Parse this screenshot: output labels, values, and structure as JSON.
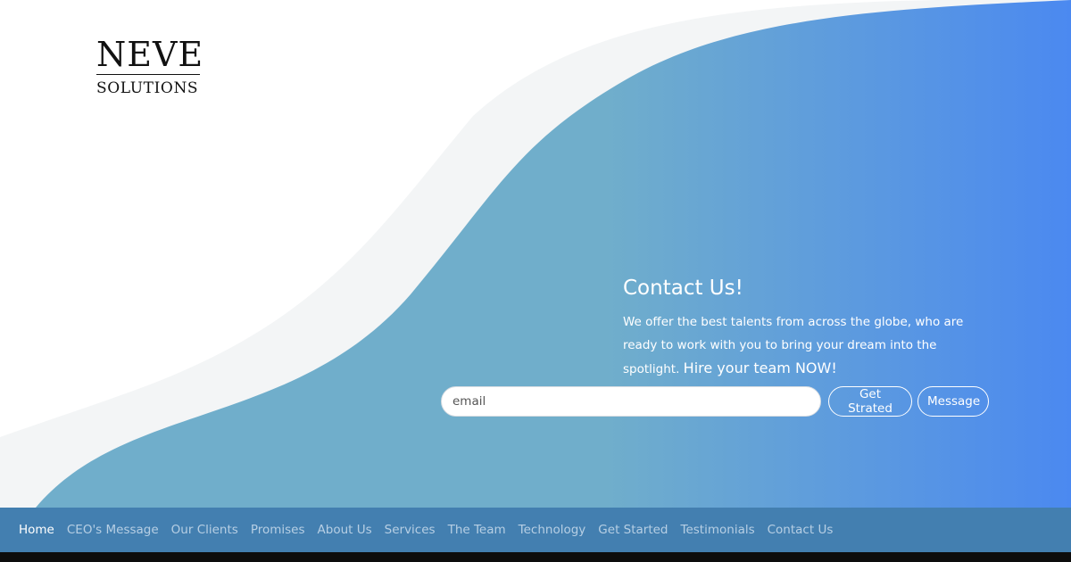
{
  "logo": {
    "main": "NEVE",
    "sub": "SOLUTIONS"
  },
  "hero": {
    "title": "Contact Us!",
    "description": "We offer the best talents from across the globe, who are ready to work with you to bring your dream into the spotlight.",
    "highlight": "Hire your team NOW!"
  },
  "form": {
    "email_placeholder": "email",
    "start_label": "Get Strated",
    "message_label": "Message"
  },
  "nav": {
    "items": [
      {
        "label": "Home",
        "active": true
      },
      {
        "label": "CEO's Message",
        "active": false
      },
      {
        "label": "Our Clients",
        "active": false
      },
      {
        "label": "Promises",
        "active": false
      },
      {
        "label": "About Us",
        "active": false
      },
      {
        "label": "Services",
        "active": false
      },
      {
        "label": "The Team",
        "active": false
      },
      {
        "label": "Technology",
        "active": false
      },
      {
        "label": "Get Started",
        "active": false
      },
      {
        "label": "Testimonials",
        "active": false
      },
      {
        "label": "Contact Us",
        "active": false
      }
    ]
  },
  "colors": {
    "gradient_start": "#70aecb",
    "gradient_end": "#4b89f0",
    "wave_back": "#f3f5f6",
    "navbar": "#437fb0",
    "nav_text": "#b7cfe4",
    "nav_active": "#ffffff"
  }
}
